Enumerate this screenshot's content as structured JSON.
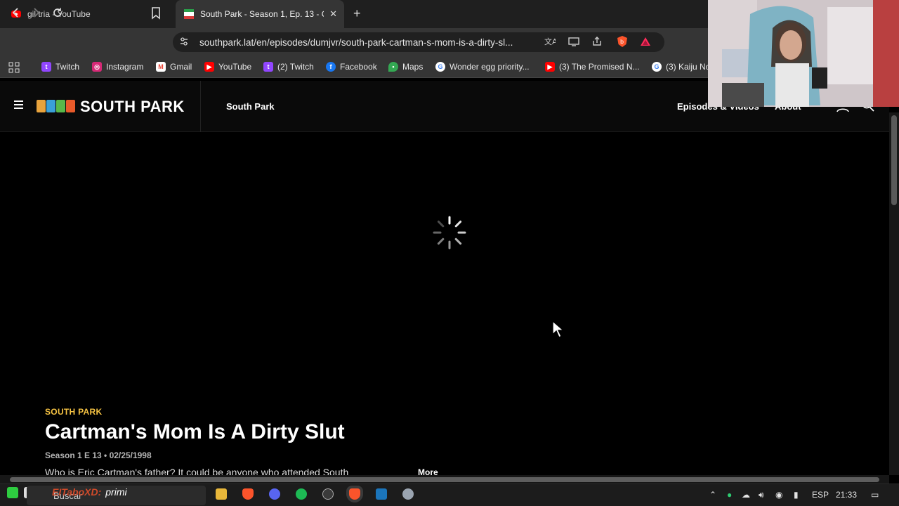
{
  "browser": {
    "tabs": [
      {
        "label": "gil tria - YouTube",
        "active": false
      },
      {
        "label": "South Park - Season 1, Ep. 13 - C",
        "active": true
      }
    ],
    "url": "southpark.lat/en/episodes/dumjvr/south-park-cartman-s-mom-is-a-dirty-sl...",
    "bookmarks": [
      {
        "label": "Twitch",
        "icon": "twitch-icon",
        "color": "#9146ff"
      },
      {
        "label": "Instagram",
        "icon": "instagram-icon",
        "color": "#d62976"
      },
      {
        "label": "Gmail",
        "icon": "gmail-icon",
        "color": "#ea4335"
      },
      {
        "label": "YouTube",
        "icon": "youtube-icon",
        "color": "#ff0000"
      },
      {
        "label": "(2) Twitch",
        "icon": "twitch-icon",
        "color": "#9146ff"
      },
      {
        "label": "Facebook",
        "icon": "facebook-icon",
        "color": "#1877f2"
      },
      {
        "label": "Maps",
        "icon": "maps-icon",
        "color": "#34a853"
      },
      {
        "label": "Wonder egg priority...",
        "icon": "google-icon",
        "color": "#ffffff"
      },
      {
        "label": "(3) The Promised N...",
        "icon": "youtube-icon",
        "color": "#ff0000"
      },
      {
        "label": "(3) Kaiju No",
        "icon": "google-icon",
        "color": "#ffffff"
      }
    ]
  },
  "site": {
    "logo": "SOUTH PARK",
    "nav_title": "South Park",
    "nav_links": [
      "Episodes & Videos",
      "About"
    ]
  },
  "episode": {
    "brand": "SOUTH PARK",
    "title": "Cartman's Mom Is A Dirty Slut",
    "meta": "Season 1 E 13 • 02/25/1998",
    "description": "Who is Eric Cartman's father? It could be anyone who attended South",
    "more_label": "More"
  },
  "taskbar": {
    "search_placeholder": "Buscar",
    "chat_user": "EITaboXD:",
    "chat_message": "primi",
    "lang": "ESP",
    "time": "21:33"
  },
  "colors": {
    "accent_brand": "#f6c343",
    "background": "#000000"
  }
}
